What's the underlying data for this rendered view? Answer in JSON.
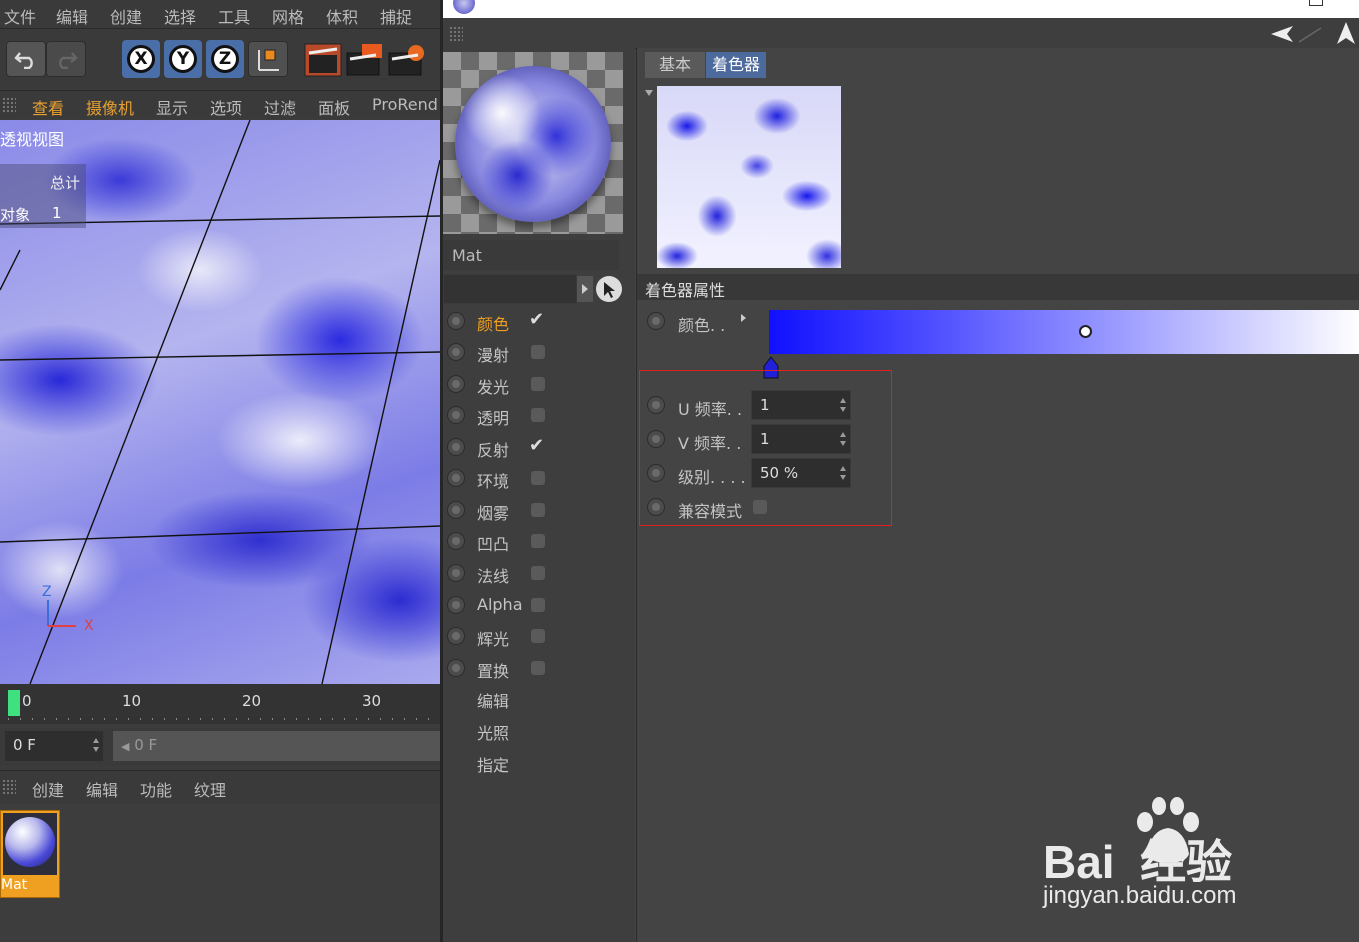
{
  "main_menu": [
    "文件",
    "编辑",
    "创建",
    "选择",
    "工具",
    "网格",
    "体积",
    "捕捉"
  ],
  "viewport_menu": [
    "查看",
    "摄像机",
    "显示",
    "选项",
    "过滤",
    "面板",
    "ProRend"
  ],
  "viewport": {
    "title": "透视视图",
    "hud_header": "总计",
    "hud_label": "对象",
    "hud_value": "1",
    "axis_z": "Z",
    "axis_x": "X"
  },
  "timeline": {
    "ticks": [
      "0",
      "10",
      "20",
      "30"
    ],
    "frame_field": "0 F",
    "frame_field2": "0 F"
  },
  "material_menu": [
    "创建",
    "编辑",
    "功能",
    "纹理"
  ],
  "material_thumb_label": "Mat",
  "editor": {
    "name": "Mat",
    "tabs": [
      "基本",
      "着色器"
    ],
    "active_tab": "着色器",
    "section_title": "着色器属性",
    "channels": [
      {
        "label": "颜色",
        "checked": true,
        "highlight": true
      },
      {
        "label": "漫射",
        "checked": false
      },
      {
        "label": "发光",
        "checked": false
      },
      {
        "label": "透明",
        "checked": false
      },
      {
        "label": "反射",
        "checked": true
      },
      {
        "label": "环境",
        "checked": false
      },
      {
        "label": "烟雾",
        "checked": false
      },
      {
        "label": "凹凸",
        "checked": false
      },
      {
        "label": "法线",
        "checked": false
      },
      {
        "label": "Alpha",
        "checked": false
      },
      {
        "label": "辉光",
        "checked": false
      },
      {
        "label": "置换",
        "checked": false
      }
    ],
    "extra_items": [
      "编辑",
      "光照",
      "指定"
    ],
    "props": {
      "color_label": "颜色. .",
      "u_label": "U 频率. .",
      "u_value": "1",
      "v_label": "V 频率. .",
      "v_value": "1",
      "level_label": "级别. . . .",
      "level_value": "50 %",
      "compat_label": "兼容模式"
    },
    "gradient_start": "#1010ff",
    "gradient_end": "#ffffff"
  },
  "watermark": {
    "text": "Bai  经验",
    "url": "jingyan.baidu.com"
  },
  "colors": {
    "accent_orange": "#f0a020",
    "highlight_red": "#e02020",
    "selected_tab": "#4d6a9c"
  }
}
